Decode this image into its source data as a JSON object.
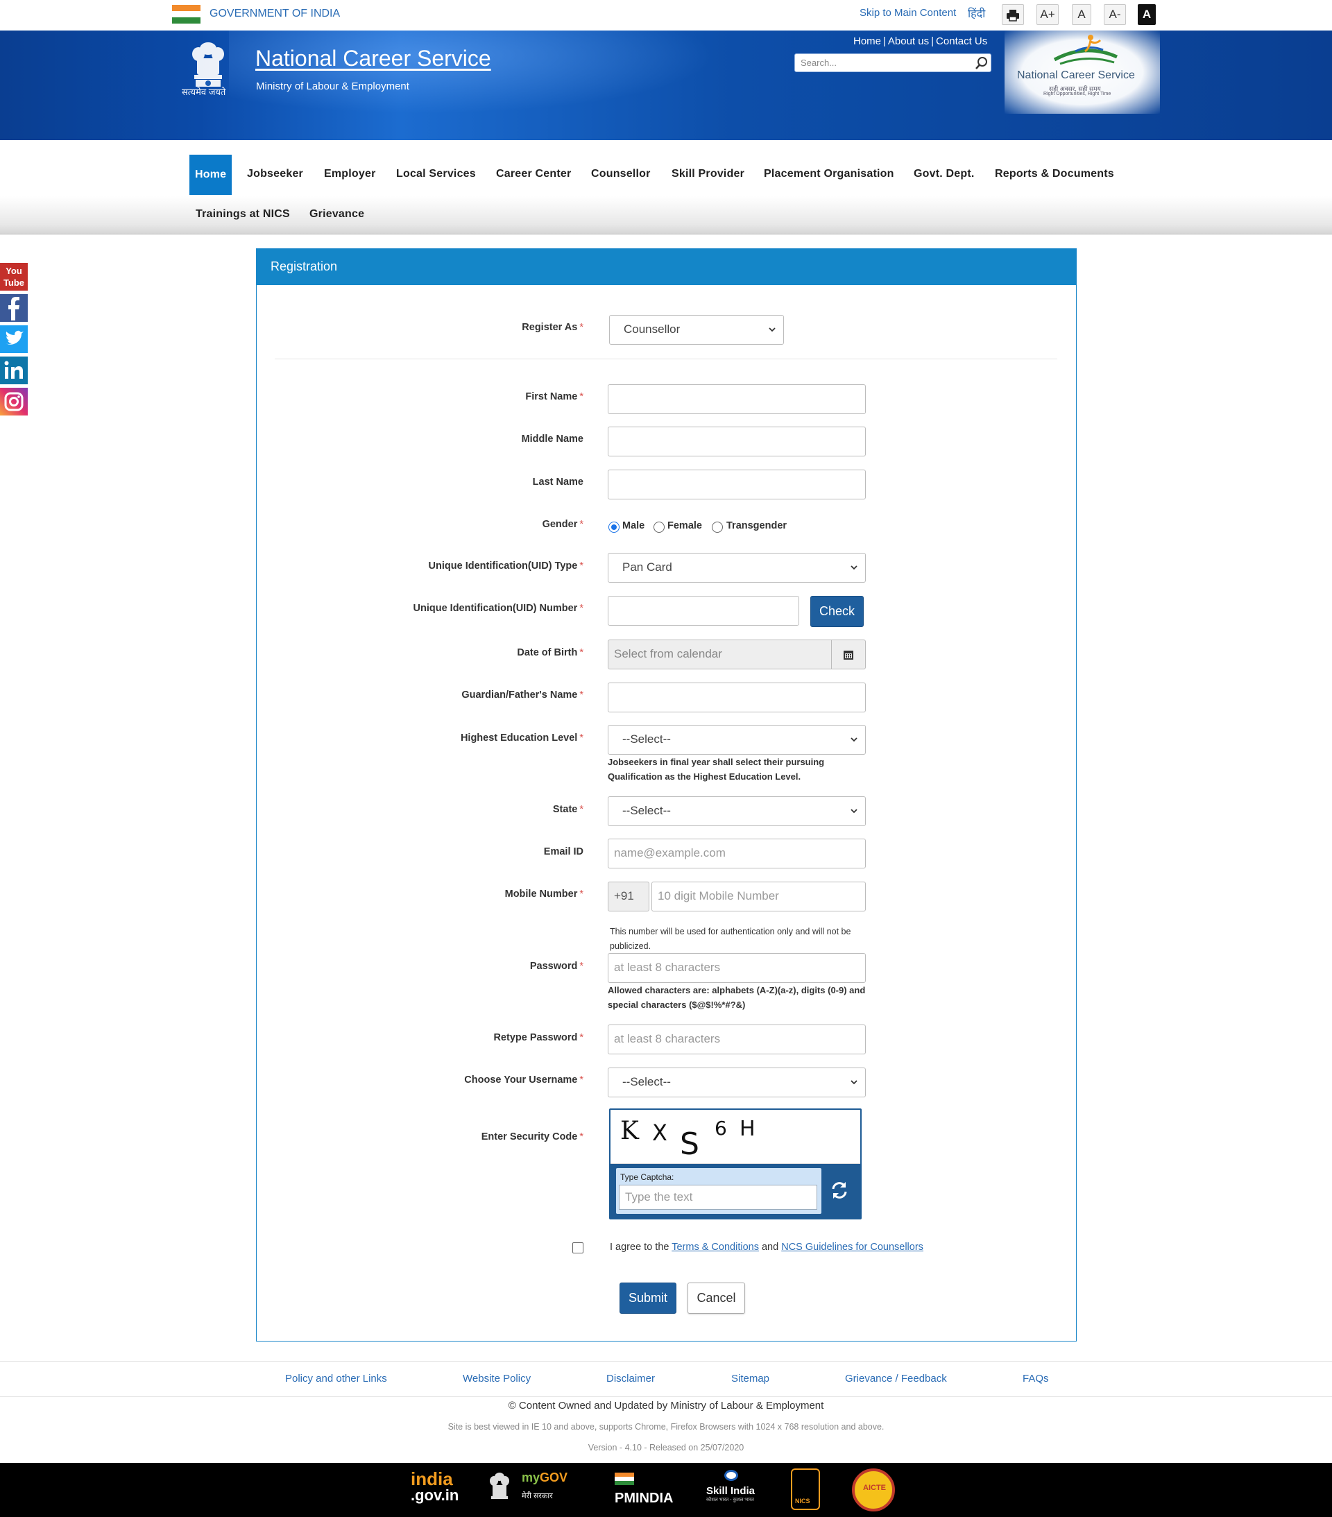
{
  "topbar": {
    "gov_label": "GOVERNMENT OF INDIA",
    "skip_link": "Skip to Main Content",
    "hindi_link": "हिंदी",
    "font_increase": "A+",
    "font_normal": "A",
    "font_decrease": "A-",
    "contrast": "A"
  },
  "header": {
    "emblem_caption": "सत्यमेव जयते",
    "title": "National Career Service",
    "subtitle": "Ministry of Labour & Employment",
    "links": [
      "Home",
      "About us",
      "Contact Us"
    ],
    "search_placeholder": "Search...",
    "logo_text": "National Career Service",
    "logo_tagline_hi": "सही अवसर, सही समय",
    "logo_tagline_en": "Right Opportunities, Right Time"
  },
  "nav": {
    "items": [
      "Home",
      "Jobseeker",
      "Employer",
      "Local Services",
      "Career Center",
      "Counsellor",
      "Skill Provider",
      "Placement Organisation",
      "Govt. Dept.",
      "Reports & Documents",
      "Trainings at NICS",
      "Grievance"
    ],
    "active": "Home"
  },
  "social": [
    "youtube-icon",
    "facebook-icon",
    "twitter-icon",
    "linkedin-icon",
    "instagram-icon"
  ],
  "social_youtube_text": [
    "You",
    "Tube"
  ],
  "form": {
    "panel_title": "Registration",
    "register_as": {
      "label": "Register As",
      "value": "Counsellor"
    },
    "first_name": {
      "label": "First Name",
      "value": ""
    },
    "middle_name": {
      "label": "Middle Name",
      "value": ""
    },
    "last_name": {
      "label": "Last Name",
      "value": ""
    },
    "gender": {
      "label": "Gender",
      "options": [
        "Male",
        "Female",
        "Transgender"
      ],
      "selected": "Male"
    },
    "uid_type": {
      "label": "Unique Identification(UID) Type",
      "value": "Pan Card"
    },
    "uid_number": {
      "label": "Unique Identification(UID) Number",
      "value": "",
      "check_button": "Check"
    },
    "dob": {
      "label": "Date of Birth",
      "placeholder": "Select from calendar"
    },
    "guardian": {
      "label": "Guardian/Father's Name",
      "value": ""
    },
    "education": {
      "label": "Highest Education Level",
      "value": "--Select--",
      "help_line1": "Jobseekers in final year shall select their pursuing",
      "help_line2": "Qualification as the Highest Education Level."
    },
    "state": {
      "label": "State",
      "value": "--Select--"
    },
    "email": {
      "label": "Email ID",
      "placeholder": "name@example.com"
    },
    "mobile": {
      "label": "Mobile Number",
      "prefix": "+91",
      "placeholder": "10 digit Mobile Number",
      "help_line1": "This number will be used for authentication only and will not be",
      "help_line2": "publicized."
    },
    "password": {
      "label": "Password",
      "placeholder": "at least 8 characters",
      "help_line1": "Allowed characters are: alphabets (A-Z)(a-z), digits (0-9) and",
      "help_line2": "special characters ($@$!%*#?&)"
    },
    "retype_password": {
      "label": "Retype Password",
      "placeholder": "at least 8 characters"
    },
    "username": {
      "label": "Choose Your Username",
      "value": "--Select--"
    },
    "captcha": {
      "label": "Enter Security Code",
      "chars": [
        "K",
        "X",
        "S",
        "6",
        "H"
      ],
      "type_label": "Type Captcha:",
      "placeholder": "Type the text"
    },
    "agree": {
      "prefix": "I agree to the",
      "terms_link": "Terms & Conditions",
      "and": "and",
      "guidelines_link": "NCS Guidelines for Counsellors"
    },
    "submit_label": "Submit",
    "cancel_label": "Cancel",
    "required_mark": "*"
  },
  "footer": {
    "links": [
      "Policy and other Links",
      "Website Policy",
      "Disclaimer",
      "Sitemap",
      "Grievance / Feedback",
      "FAQs"
    ],
    "copyright": "© Content Owned and Updated by Ministry of Labour & Employment",
    "browser_note": "Site is best viewed in IE 10 and above, supports Chrome, Firefox Browsers with 1024 x 768 resolution and above.",
    "version": "Version - 4.10 - Released on 25/07/2020",
    "partner_logos": [
      "india.gov.in",
      "my GOV मेरी सरकार",
      "PMINDIA",
      "Skill India",
      "NICS",
      "AICTE"
    ],
    "partner_text": {
      "indiagov_1": "india",
      "indiagov_2": ".gov.in",
      "mygov_1": "my",
      "mygov_2": "GOV",
      "mygov_3": "मेरी सरकार",
      "pmindia": "PMINDIA",
      "skill_india": "Skill India",
      "skill_tag": "कौशल भारत - कुशल भारत",
      "nics": "NICS",
      "aicte": "AICTE"
    }
  }
}
